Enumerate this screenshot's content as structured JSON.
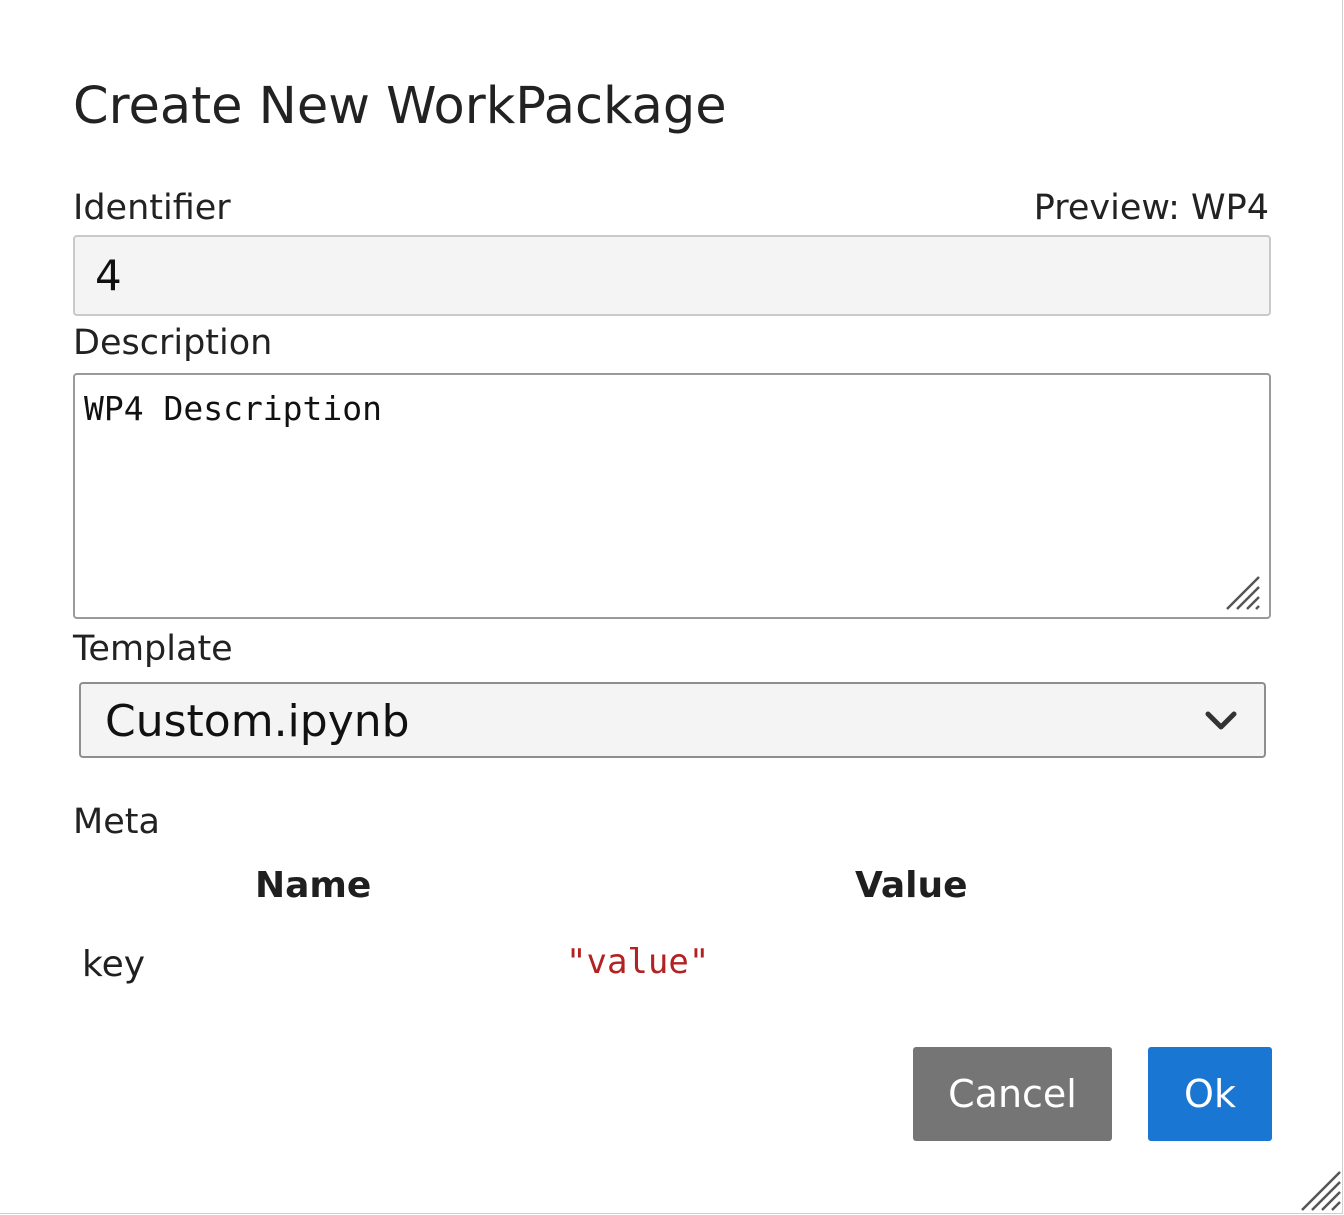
{
  "dialog": {
    "title": "Create New WorkPackage"
  },
  "identifier": {
    "label": "Identifier",
    "preview": "Preview: WP4",
    "value": "4"
  },
  "description": {
    "label": "Description",
    "value": "WP4 Description"
  },
  "template": {
    "label": "Template",
    "selected": "Custom.ipynb"
  },
  "meta": {
    "label": "Meta",
    "columns": [
      "Name",
      "Value"
    ],
    "rows": [
      {
        "name": "key",
        "value": "\"value\""
      }
    ]
  },
  "buttons": {
    "cancel": "Cancel",
    "ok": "Ok"
  },
  "icons": {
    "select_arrow": "chevron-down-icon",
    "textarea_grip": "resize-grip-icon",
    "dialog_grip": "resize-grip-icon"
  },
  "colors": {
    "ok_button": "#1976d2",
    "cancel_button": "#757575",
    "meta_value": "#b22222"
  }
}
